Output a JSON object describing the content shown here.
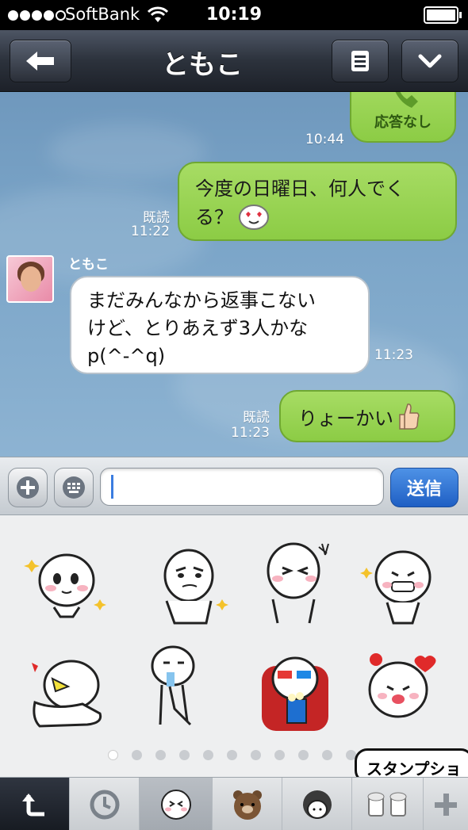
{
  "status_bar": {
    "carrier": "SoftBank",
    "time": "10:19",
    "signal_bars_filled": 4,
    "signal_bars_total": 5
  },
  "header": {
    "title": "ともこ",
    "back_icon": "back-arrow-icon",
    "menu_icon": "menu-icon",
    "dropdown_icon": "chevron-down-icon"
  },
  "chat": {
    "messages": [
      {
        "side": "right",
        "type": "call",
        "text": "応答なし",
        "time": "10:44",
        "read": ""
      },
      {
        "side": "right",
        "type": "text",
        "text": "今度の日曜日、何人でくる？",
        "time": "11:22",
        "read": "既読"
      },
      {
        "side": "left",
        "sender": "ともこ",
        "type": "text",
        "text": "まだみんなから返事こないけど、とりあえず3人かなp(^-^q)",
        "line1": "まだみんなから返事こない",
        "line2": "けど、とりあえず3人かな",
        "line3": "p(^-^q)",
        "time": "11:23"
      },
      {
        "side": "right",
        "type": "text",
        "text": "りょーかい",
        "time": "11:23",
        "read": "既読"
      }
    ],
    "msg2_line1": "今度の日曜日、何人でく",
    "msg2_line2": "る？"
  },
  "input_bar": {
    "value": "",
    "send_label": "送信"
  },
  "sticker_panel": {
    "page_count": 11,
    "active_page": 1,
    "tooltip": "スタンプショ"
  },
  "tabs": [
    "undo-icon",
    "history-clock-icon",
    "moon-sticker-icon",
    "brown-bear-icon",
    "girl-sticker-icon",
    "beer-sticker-icon",
    "add-icon"
  ],
  "colors": {
    "accent_green": "#8ccc45",
    "send_blue": "#1f5fc4",
    "header_dark": "#2c323c"
  }
}
